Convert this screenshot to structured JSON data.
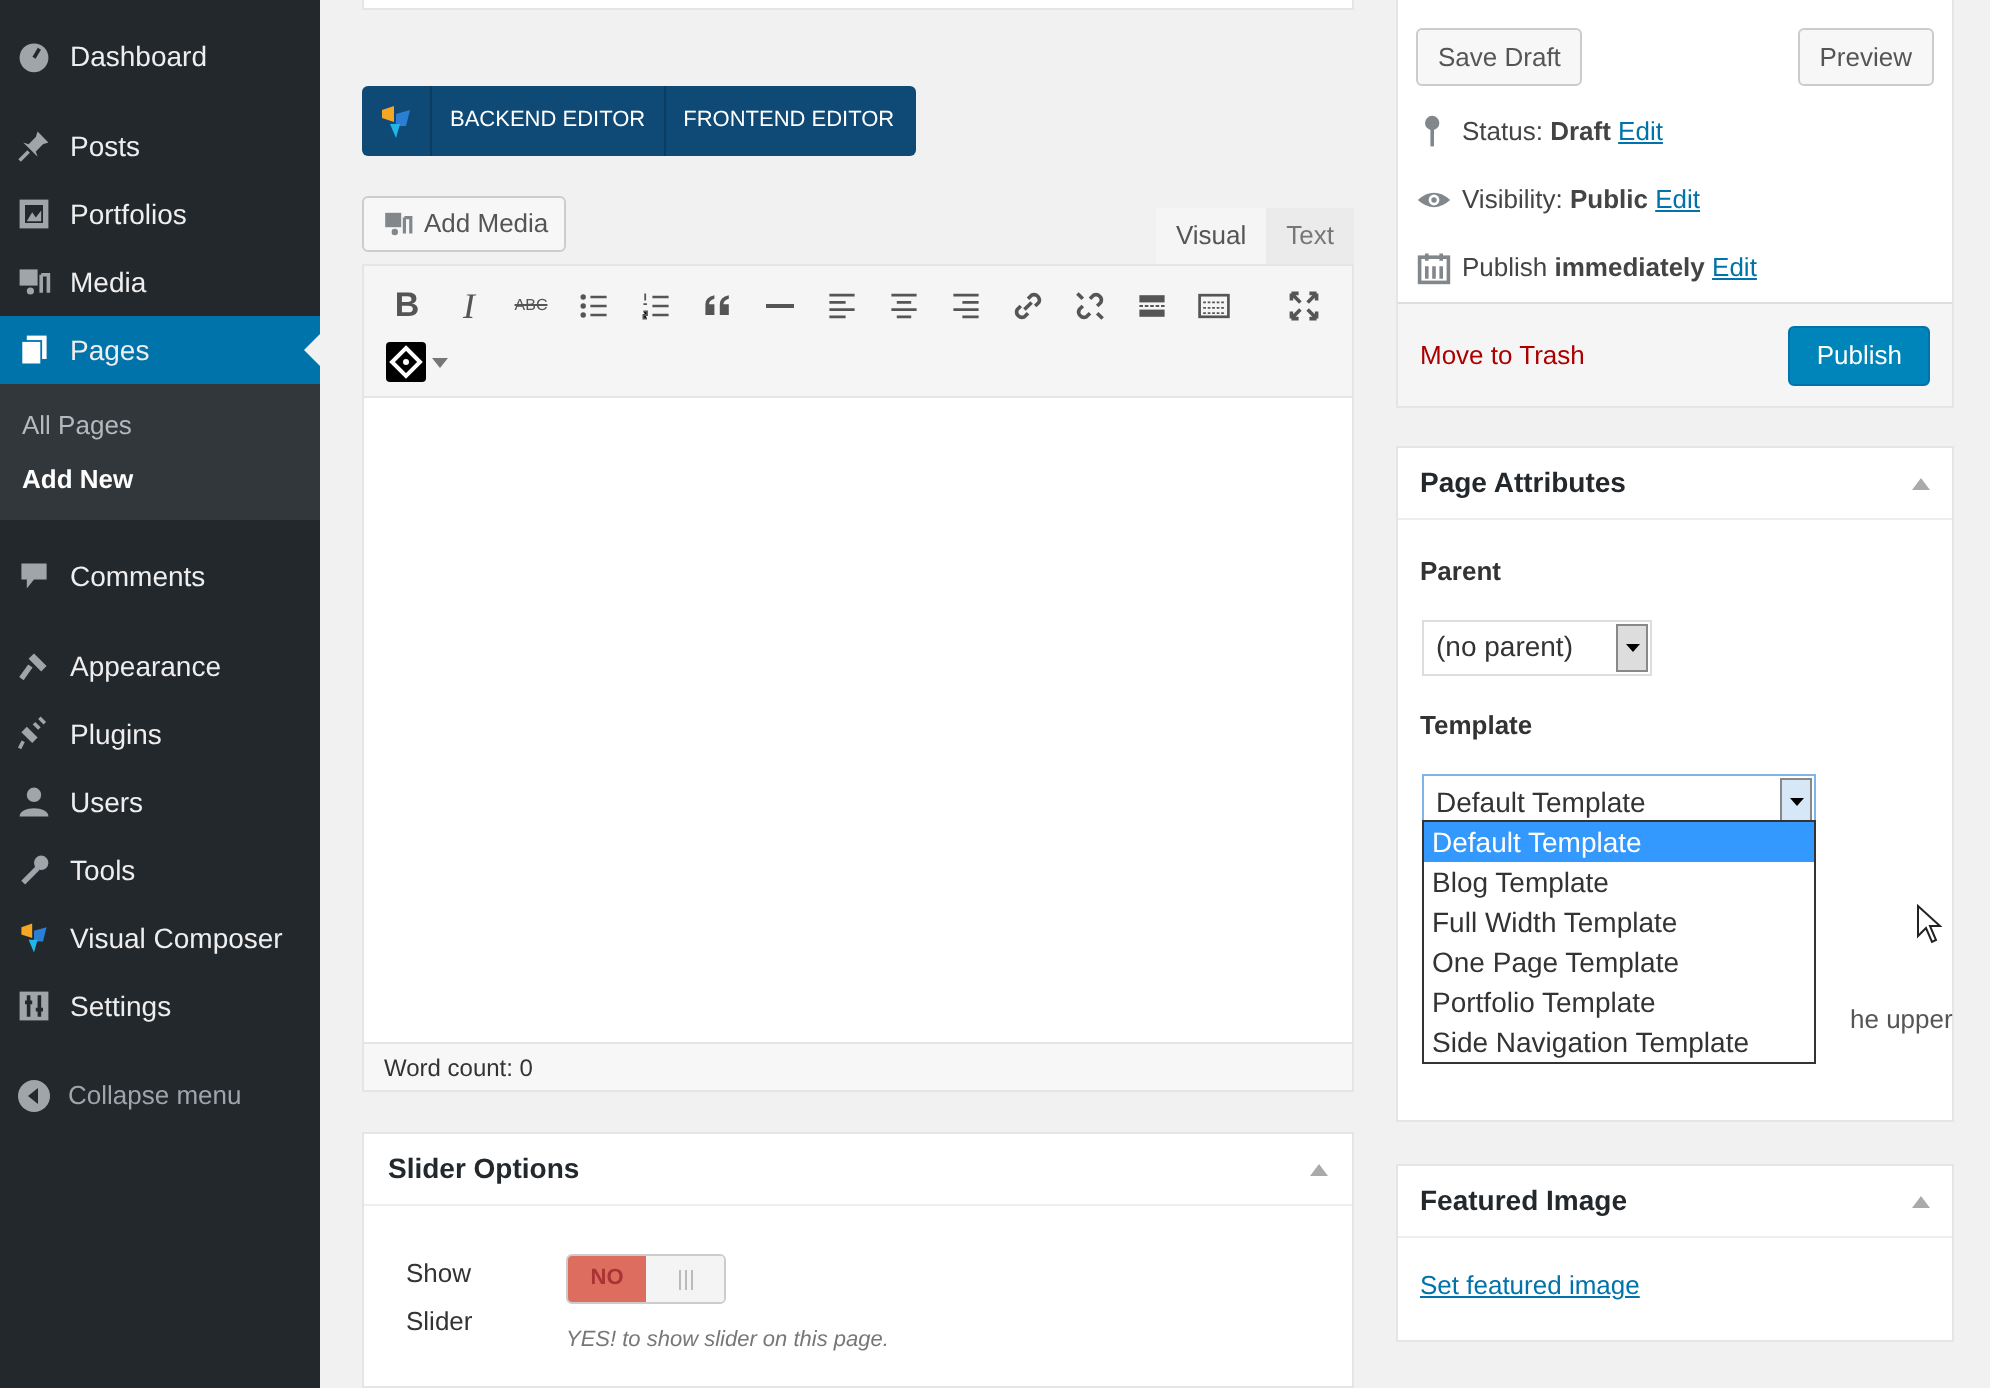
{
  "sidebar": {
    "items": [
      {
        "label": "Dashboard",
        "selected": false
      },
      {
        "label": "Posts",
        "selected": false
      },
      {
        "label": "Portfolios",
        "selected": false
      },
      {
        "label": "Media",
        "selected": false
      },
      {
        "label": "Pages",
        "selected": true,
        "submenu": [
          {
            "label": "All Pages",
            "selected": false
          },
          {
            "label": "Add New",
            "selected": true
          }
        ]
      },
      {
        "label": "Comments",
        "selected": false
      },
      {
        "label": "Appearance",
        "selected": false
      },
      {
        "label": "Plugins",
        "selected": false
      },
      {
        "label": "Users",
        "selected": false
      },
      {
        "label": "Tools",
        "selected": false
      },
      {
        "label": "Visual Composer",
        "selected": false
      },
      {
        "label": "Settings",
        "selected": false
      }
    ],
    "collapse": "Collapse menu"
  },
  "composer_bar": {
    "buttons": [
      "BACKEND EDITOR",
      "FRONTEND EDITOR"
    ]
  },
  "editor": {
    "add_media": "Add Media",
    "tabs": [
      {
        "label": "Visual",
        "selected": true
      },
      {
        "label": "Text",
        "selected": false
      }
    ],
    "toolbar": [
      {
        "kind": "bold",
        "label": "B"
      },
      {
        "kind": "italic",
        "label": "I"
      },
      {
        "kind": "strike",
        "label": "ABC"
      },
      {
        "kind": "bullets"
      },
      {
        "kind": "numbers"
      },
      {
        "kind": "quote"
      },
      {
        "kind": "rule"
      },
      {
        "kind": "align-left"
      },
      {
        "kind": "align-center"
      },
      {
        "kind": "align-right"
      },
      {
        "kind": "link"
      },
      {
        "kind": "unlink"
      },
      {
        "kind": "more"
      },
      {
        "kind": "kitchen"
      },
      {
        "kind": "fullscreen"
      },
      {
        "kind": "shortcode"
      }
    ],
    "word_count": "Word count: 0"
  },
  "slider_options": {
    "title": "Slider Options",
    "label": "Show Slider",
    "toggle": {
      "label": "NO",
      "on": false
    },
    "hint": "YES! to show slider on this page."
  },
  "publish": {
    "save_draft": "Save Draft",
    "preview": "Preview",
    "rows": [
      {
        "label": "Status:",
        "value": "Draft",
        "link": "Edit"
      },
      {
        "label": "Visibility:",
        "value": "Public",
        "link": "Edit"
      },
      {
        "label": "Publish",
        "value": "immediately",
        "link": "Edit"
      }
    ],
    "trash": "Move to Trash",
    "publish": "Publish"
  },
  "page_attributes": {
    "title": "Page Attributes",
    "parent_label": "Parent",
    "parent_value": "(no parent)",
    "template_label": "Template",
    "template_value": "Default Template",
    "template_options": [
      {
        "label": "Default Template",
        "selected": true
      },
      {
        "label": "Blog Template",
        "selected": false
      },
      {
        "label": "Full Width Template",
        "selected": false
      },
      {
        "label": "One Page Template",
        "selected": false
      },
      {
        "label": "Portfolio Template",
        "selected": false
      },
      {
        "label": "Side Navigation Template",
        "selected": false
      }
    ],
    "help_fragment": "he upper"
  },
  "featured_image": {
    "title": "Featured Image",
    "link": "Set featured image"
  }
}
